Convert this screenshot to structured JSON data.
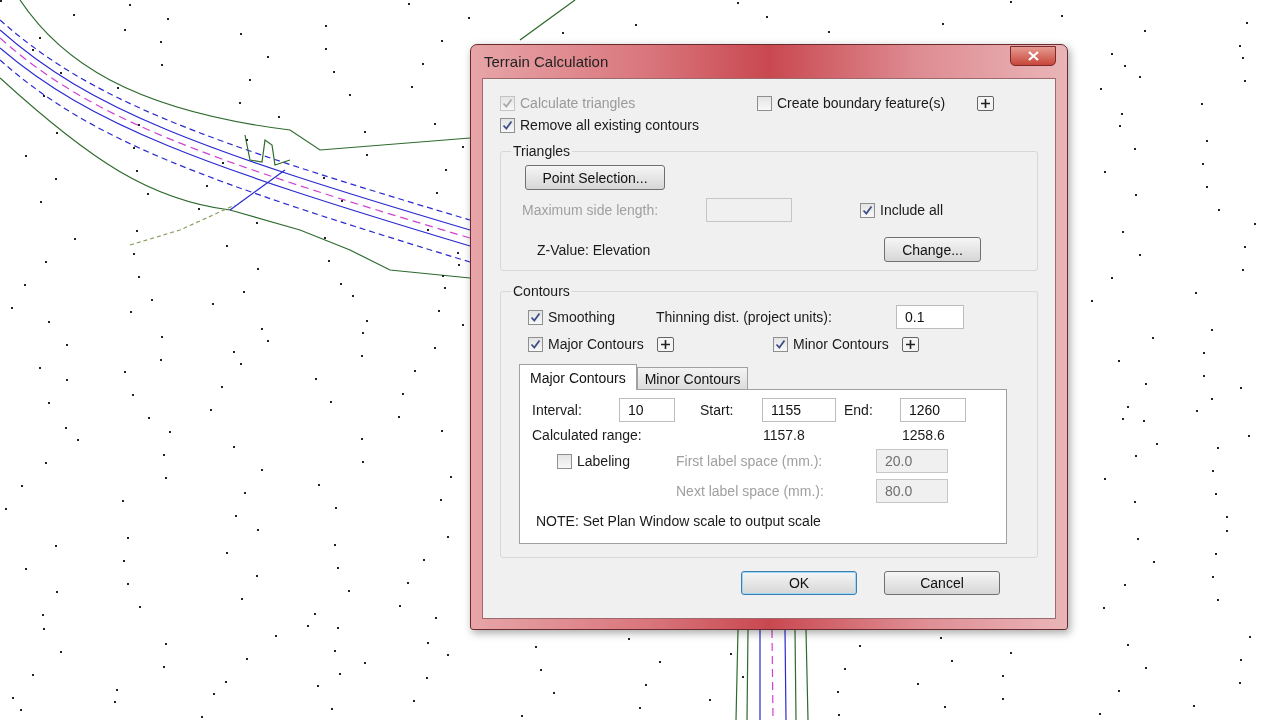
{
  "window": {
    "title": "Terrain Calculation"
  },
  "options": [
    {
      "label": "Calculate triangles",
      "checked": true,
      "disabled": true
    },
    {
      "label": "Create boundary feature(s)",
      "checked": false,
      "disabled": false,
      "expandable": true
    },
    {
      "label": "Remove all existing contours",
      "checked": true,
      "disabled": false
    }
  ],
  "triangles": {
    "title": "Triangles",
    "point_selection_button": "Point Selection...",
    "max_side_length": {
      "label": "Maximum side length:",
      "disabled": true
    },
    "include_all": {
      "label": "Include all",
      "checked": true,
      "disabled": false
    },
    "z_value": "Z-Value:  Elevation",
    "change_button": "Change..."
  },
  "contours": {
    "title": "Contours",
    "smoothing": {
      "label": "Smoothing",
      "checked": true,
      "disabled": false
    },
    "thinning": {
      "label": "Thinning dist. (project units):",
      "value": "0.1"
    },
    "major": {
      "label": "Major Contours",
      "checked": true,
      "disabled": false,
      "expandable": true
    },
    "minor": {
      "label": "Minor Contours",
      "checked": true,
      "disabled": false,
      "expandable": true
    },
    "tabs": [
      {
        "label": "Major Contours",
        "selected": true
      },
      {
        "label": "Minor Contours",
        "selected": false
      }
    ],
    "panel": {
      "interval": {
        "label": "Interval:",
        "value": "10"
      },
      "start": {
        "label": "Start:",
        "value": "1155"
      },
      "end": {
        "label": "End:",
        "value": "1260"
      },
      "calculated_range": {
        "label": "Calculated range:",
        "start": "1157.8",
        "end": "1258.6"
      },
      "labeling": {
        "label": "Labeling",
        "checked": false,
        "disabled": false
      },
      "first_label_space": {
        "label": "First label space (mm.):",
        "value": "20.0",
        "disabled": true
      },
      "next_label_space": {
        "label": "Next label space (mm.):",
        "value": "80.0",
        "disabled": true
      },
      "note": "NOTE: Set Plan Window scale to output scale"
    }
  },
  "buttons": [
    {
      "label": "OK",
      "default": true
    },
    {
      "label": "Cancel",
      "default": false
    }
  ]
}
